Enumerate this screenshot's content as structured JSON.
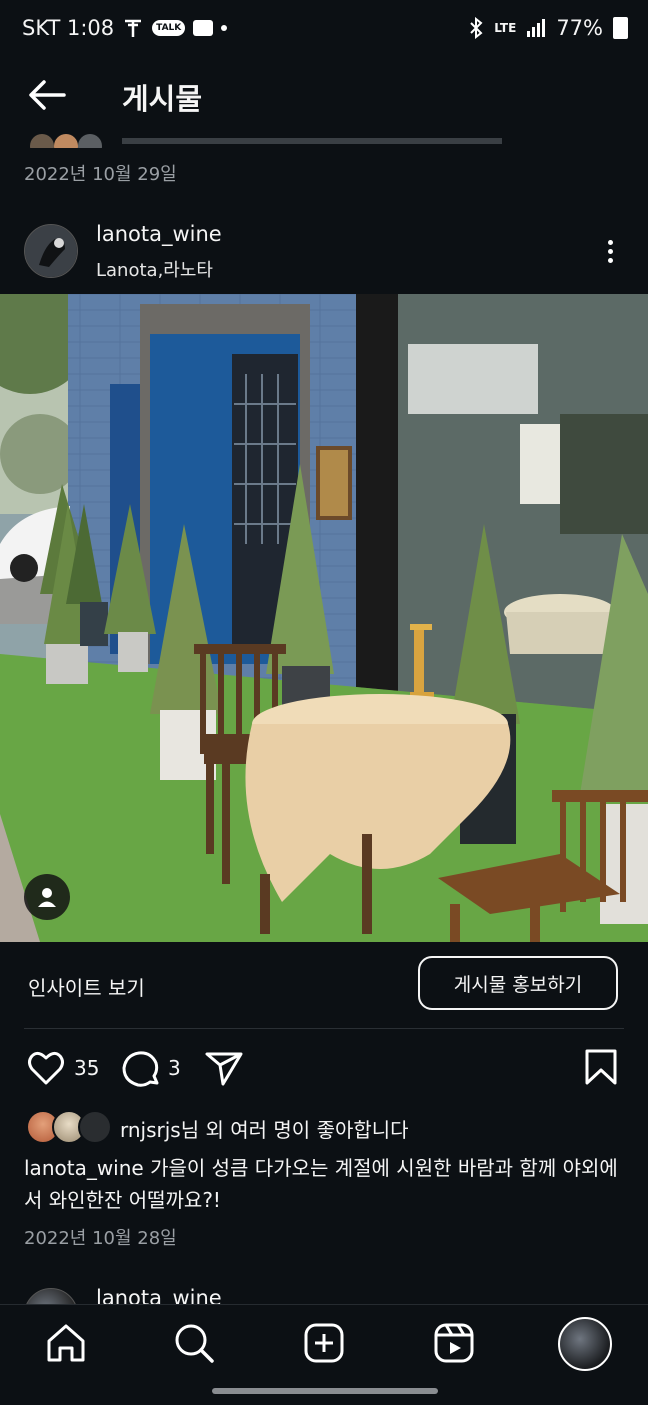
{
  "status_bar": {
    "carrier_time": "SKT 1:08",
    "icons": [
      "t-icon",
      "kakaotalk-icon",
      "message-icon",
      "dot-icon"
    ],
    "talk_label": "TALK",
    "network": "LTE",
    "battery": "77%"
  },
  "header": {
    "back_icon": "arrow-left-icon",
    "title": "게시물"
  },
  "previous_post": {
    "date": "2022년 10월 29일"
  },
  "post": {
    "username": "lanota_wine",
    "location": "Lanota,라노타",
    "photo_alt": "Outdoor terrace with round table, wooden chairs and potted cypress trees in front of blue wine bar",
    "insights_label": "인사이트 보기",
    "promote_label": "게시물 홍보하기",
    "like_count": "35",
    "comment_count": "3",
    "likes_user": "rnjsrjs",
    "likes_suffix": "님 외 여러 명이 좋아합니다",
    "caption_user": "lanota_wine",
    "caption_text": " 가을이 성큼 다가오는 계절에 시원한 바람과 함께 야외에서 와인한잔 어떨까요?!",
    "date": "2022년 10월 28일"
  },
  "next_post": {
    "username": "lanota_wine"
  },
  "bottom_nav": {
    "items": [
      "home-icon",
      "search-icon",
      "create-icon",
      "reels-icon",
      "profile-icon"
    ]
  },
  "colors": {
    "background": "#0c1014",
    "text": "#f5f5f5",
    "muted": "#9a9fa4"
  }
}
